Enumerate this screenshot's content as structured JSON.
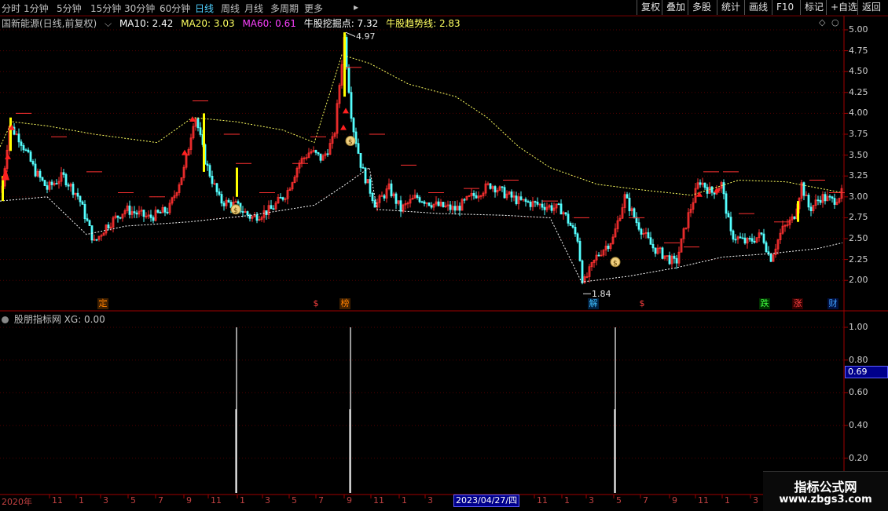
{
  "toolbar": {
    "timeframes": [
      "分时",
      "1分钟",
      "5分钟",
      "15分钟",
      "30分钟",
      "60分钟",
      "日线",
      "周线",
      "月线",
      "多周期",
      "更多"
    ],
    "active_timeframe": "日线",
    "tools": [
      "复权",
      "叠加",
      "多股",
      "统计",
      "画线",
      "F10",
      "标记",
      "+自选",
      "返回"
    ]
  },
  "main_chart": {
    "stock_title": "国新能源(日线,前复权)",
    "ma10": "MA10: 2.42",
    "ma20": "MA20: 3.03",
    "ma60": "MA60: 0.61",
    "niugu_point": "牛股挖掘点: 7.32",
    "niugu_trend": "牛股趋势线: 2.83",
    "y_ticks": [
      "5.00",
      "4.75",
      "4.50",
      "4.25",
      "4.00",
      "3.75",
      "3.50",
      "3.25",
      "3.00",
      "2.75",
      "2.50",
      "2.25",
      "2.00"
    ],
    "high_label": "4.97",
    "low_label": "1.84",
    "event_markers": [
      {
        "text": "定",
        "color": "#ff8000",
        "bg": "#402000"
      },
      {
        "text": "$",
        "color": "#ff4040",
        "bg": "#000"
      },
      {
        "text": "榜",
        "color": "#ff8000",
        "bg": "#402000"
      },
      {
        "text": "解",
        "color": "#40c0ff",
        "bg": "#002040"
      },
      {
        "text": "$",
        "color": "#ff4040",
        "bg": "#000"
      },
      {
        "text": "跌",
        "color": "#40ff40",
        "bg": "#003000"
      },
      {
        "text": "涨",
        "color": "#ff4040",
        "bg": "#300000"
      },
      {
        "text": "财",
        "color": "#40a0ff",
        "bg": "#001040"
      }
    ],
    "colors": {
      "up": "#ff3030",
      "down": "#54ffff",
      "ma_yellow": "#ffff60",
      "ma_white": "#ffffff",
      "axis": "#c04040"
    }
  },
  "sub_chart": {
    "title": "股朋指标网",
    "xg_label": "XG: 0.00",
    "y_ticks": [
      "1.00",
      "0.80",
      "0.60",
      "0.40",
      "0.20"
    ],
    "current_value": "0.69",
    "signals": [
      1,
      1,
      1
    ]
  },
  "x_axis": {
    "labels": [
      "2020年",
      "11",
      "1",
      "3",
      "5",
      "7",
      "9",
      "11",
      "1",
      "3",
      "5",
      "7",
      "9",
      "11",
      "1",
      "3",
      "11",
      "1",
      "3",
      "5",
      "7",
      "9",
      "11",
      "1",
      "3"
    ],
    "selected_date": "2023/04/27/四"
  },
  "watermark": {
    "line1": "指标公式网",
    "line2": "www.zbgs3.com"
  },
  "chart_data": {
    "type": "candlestick",
    "price_range": [
      1.84,
      4.97
    ],
    "high": 4.97,
    "low": 1.84,
    "ylim": [
      1.75,
      5.1
    ],
    "indicator_ylim": [
      0,
      1.1
    ]
  }
}
